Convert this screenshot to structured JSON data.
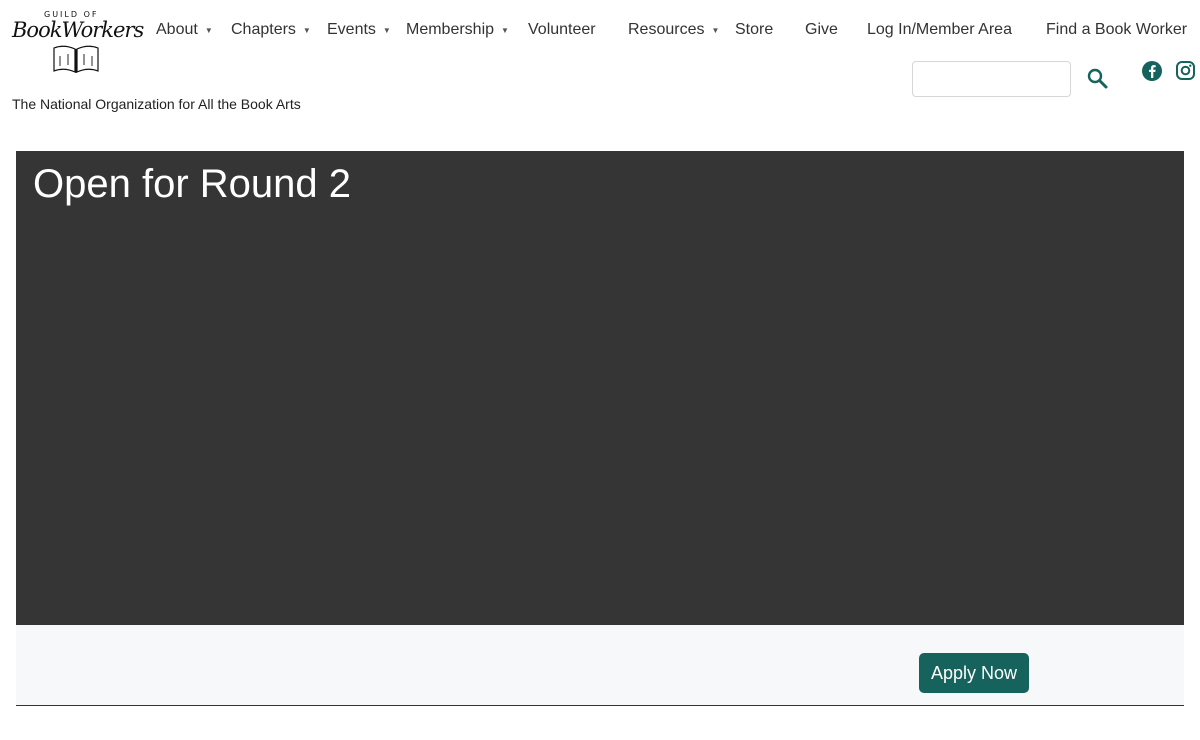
{
  "site": {
    "logo_small": "GUILD OF",
    "logo_main": "BookWorkers",
    "tagline": "The National Organization for All the Book Arts"
  },
  "nav": {
    "items": [
      {
        "label": "About",
        "has_dropdown": true
      },
      {
        "label": "Chapters",
        "has_dropdown": true
      },
      {
        "label": "Events",
        "has_dropdown": true
      },
      {
        "label": "Membership",
        "has_dropdown": true
      },
      {
        "label": "Volunteer",
        "has_dropdown": false
      },
      {
        "label": "Resources",
        "has_dropdown": true
      },
      {
        "label": "Store",
        "has_dropdown": false
      },
      {
        "label": "Give",
        "has_dropdown": false
      },
      {
        "label": "Log In/Member Area",
        "has_dropdown": false
      },
      {
        "label": "Find a Book Worker",
        "has_dropdown": false
      }
    ],
    "caret": "▼"
  },
  "search": {
    "value": "",
    "icon": "search-icon"
  },
  "social": {
    "facebook_icon": "facebook-icon",
    "instagram_icon": "instagram-icon"
  },
  "hero": {
    "title": "Open for Round 2",
    "background": "#353535"
  },
  "cta": {
    "button_label": "Apply Now",
    "button_color": "#16625c"
  },
  "colors": {
    "accent": "#16625c",
    "text": "#333333"
  }
}
